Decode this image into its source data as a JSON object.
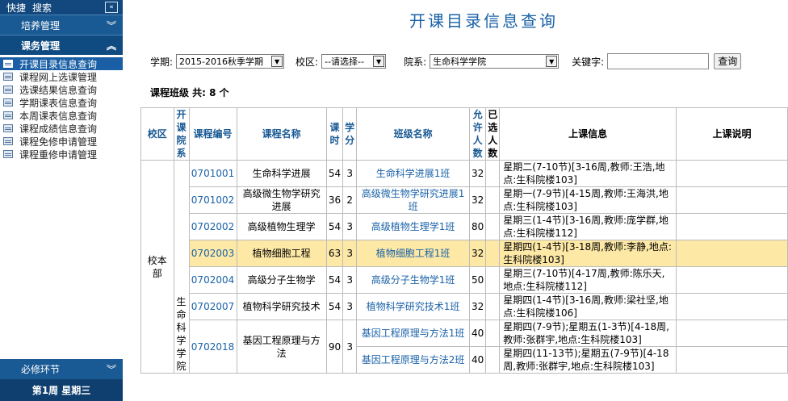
{
  "sidebar": {
    "top_links": [
      "快捷",
      "搜索"
    ],
    "collapse_glyph": "«",
    "section_peiyang": "培养管理",
    "section_kewu": "课务管理",
    "items": [
      {
        "label": "开课目录信息查询",
        "selected": true
      },
      {
        "label": "课程网上选课管理",
        "selected": false
      },
      {
        "label": "选课结果信息查询",
        "selected": false
      },
      {
        "label": "学期课表信息查询",
        "selected": false
      },
      {
        "label": "本周课表信息查询",
        "selected": false
      },
      {
        "label": "课程成绩信息查询",
        "selected": false
      },
      {
        "label": "课程免修申请管理",
        "selected": false
      },
      {
        "label": "课程重修申请管理",
        "selected": false
      }
    ],
    "section_bixiu": "必修环节",
    "week_status": "第1周 星期三"
  },
  "page": {
    "title": "开课目录信息查询"
  },
  "filters": {
    "term_label": "学期:",
    "term_value": "2015-2016秋季学期",
    "campus_label": "校区:",
    "campus_value": "--请选择--",
    "dept_label": "院系:",
    "dept_value": "生命科学学院",
    "keyword_label": "关键字:",
    "keyword_value": "",
    "query_button": "查询"
  },
  "summary": {
    "count_text": "课程班级 共: 8 个"
  },
  "table": {
    "headers": {
      "campus": "校区",
      "college": "开课院系",
      "code": "课程编号",
      "name": "课程名称",
      "hours": "课时",
      "credit": "学分",
      "class_name": "班级名称",
      "allowed": "允许人数",
      "selected": "已选人数",
      "schedule": "上课信息",
      "notes": "上课说明"
    },
    "campus_value": "校本部",
    "college_value": "生命科学学院",
    "rows": [
      {
        "code": "0701001",
        "name": "生命科学进展",
        "hours": "54",
        "credit": "3",
        "classes": [
          {
            "class_name": "生命科学进展1班",
            "allowed": "32",
            "schedule": "星期二(7-10节)[3-16周,教师:王浩,地点:生科院楼103]"
          }
        ]
      },
      {
        "code": "0701002",
        "name": "高级微生物学研究进展",
        "hours": "36",
        "credit": "2",
        "classes": [
          {
            "class_name": "高级微生物学研究进展1班",
            "allowed": "32",
            "schedule": "星期一(7-9节)[4-15周,教师:王海洪,地点:生科院楼103]"
          }
        ]
      },
      {
        "code": "0702002",
        "name": "高级植物生理学",
        "hours": "54",
        "credit": "3",
        "classes": [
          {
            "class_name": "高级植物生理学1班",
            "allowed": "80",
            "schedule": "星期三(1-4节)[3-16周,教师:庞学群,地点:生科院楼112]"
          }
        ]
      },
      {
        "code": "0702003",
        "name": "植物细胞工程",
        "hours": "63",
        "credit": "3",
        "highlight": true,
        "classes": [
          {
            "class_name": "植物细胞工程1班",
            "allowed": "32",
            "schedule": "星期四(1-4节)[3-18周,教师:李静,地点:生科院楼103]"
          }
        ]
      },
      {
        "code": "0702004",
        "name": "高级分子生物学",
        "hours": "54",
        "credit": "3",
        "classes": [
          {
            "class_name": "高级分子生物学1班",
            "allowed": "50",
            "schedule": "星期三(7-10节)[4-17周,教师:陈乐天,地点:生科院楼112]"
          }
        ]
      },
      {
        "code": "0702007",
        "name": "植物科学研究技术",
        "hours": "54",
        "credit": "3",
        "classes": [
          {
            "class_name": "植物科学研究技术1班",
            "allowed": "32",
            "schedule": "星期四(1-4节)[3-16周,教师:梁社坚,地点:生科院楼106]"
          }
        ]
      },
      {
        "code": "0702018",
        "name": "基因工程原理与方法",
        "hours": "90",
        "credit": "3",
        "classes": [
          {
            "class_name": "基因工程原理与方法1班",
            "allowed": "40",
            "schedule": "星期四(7-9节);星期五(1-3节)[4-18周,教师:张群宇,地点:生科院楼103]"
          },
          {
            "class_name": "基因工程原理与方法2班",
            "allowed": "40",
            "schedule": "星期四(11-13节);星期五(7-9节)[4-18周,教师:张群宇,地点:生科院楼103]"
          }
        ]
      }
    ]
  }
}
